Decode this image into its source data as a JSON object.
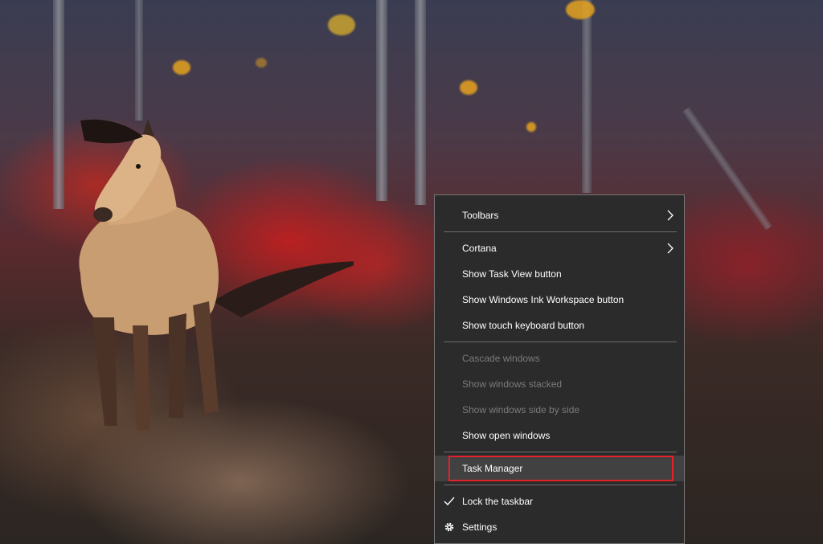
{
  "wallpaper": {
    "description_icon": "horse-in-forest-wallpaper"
  },
  "context_menu": {
    "items": [
      {
        "label": "Toolbars",
        "submenu": true,
        "enabled": true
      },
      {
        "label": "Cortana",
        "submenu": true,
        "enabled": true
      },
      {
        "label": "Show Task View button",
        "enabled": true
      },
      {
        "label": "Show Windows Ink Workspace button",
        "enabled": true
      },
      {
        "label": "Show touch keyboard button",
        "enabled": true
      },
      {
        "label": "Cascade windows",
        "enabled": false
      },
      {
        "label": "Show windows stacked",
        "enabled": false
      },
      {
        "label": "Show windows side by side",
        "enabled": false
      },
      {
        "label": "Show open windows",
        "enabled": true
      },
      {
        "label": "Task Manager",
        "enabled": true,
        "highlighted": true
      },
      {
        "label": "Lock the taskbar",
        "enabled": true,
        "checked": true
      },
      {
        "label": "Settings",
        "enabled": true,
        "icon": "gear-icon"
      }
    ]
  },
  "colors": {
    "menu_background": "#2b2b2b",
    "menu_border": "#767676",
    "disabled_text": "#7b7b7b",
    "highlight_box": "#e5222a",
    "hover_background": "#414141"
  }
}
